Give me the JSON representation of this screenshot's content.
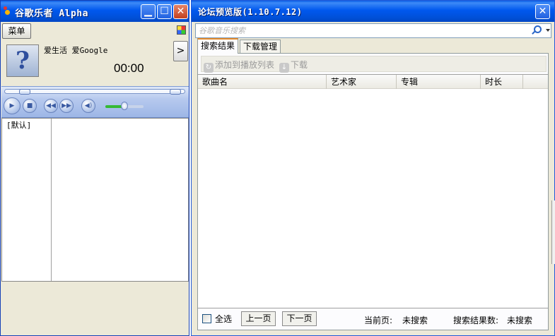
{
  "player": {
    "title": "谷歌乐者 Alpha",
    "menu_label": "菜单",
    "album_placeholder": "?",
    "song_line": "爱生活 爱Google",
    "time": "00:00",
    "next_symbol": ">",
    "volume_fraction": 0.5,
    "playlists": [
      "[默认]"
    ]
  },
  "search_window": {
    "title": "论坛预览版(1.10.7.12)",
    "search_placeholder": "谷歌音乐搜索",
    "tabs": [
      "搜索结果",
      "下载管理"
    ],
    "active_tab": 0,
    "toolbar": {
      "add_to_playlist": "添加到播放列表",
      "download": "下载"
    },
    "columns": [
      "歌曲名",
      "艺术家",
      "专辑",
      "时长"
    ],
    "rows": [],
    "footer": {
      "select_all": "全选",
      "prev_page": "上一页",
      "next_page": "下一页",
      "current_page_label": "当前页:",
      "current_page_value": "未搜索",
      "result_count_label": "搜索结果数:",
      "result_count_value": "未搜索"
    }
  },
  "colors": {
    "titlebar_blue": "#0058ee",
    "close_red": "#c3401f",
    "volume_green": "#35b935",
    "tab_accent": "#e68b2c"
  }
}
